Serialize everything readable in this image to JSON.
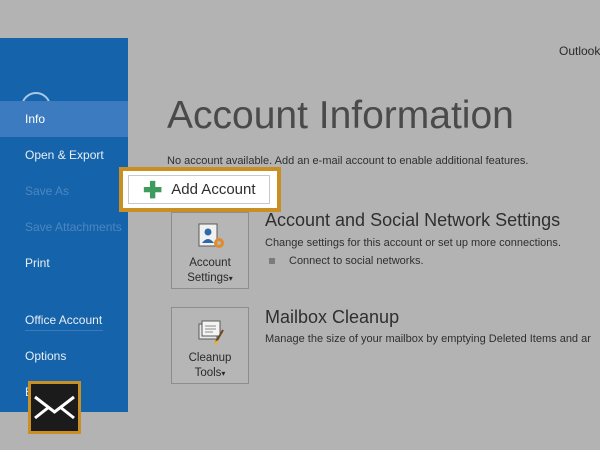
{
  "app": {
    "name": "Outlook"
  },
  "sidebar": {
    "back_label": "Back",
    "items": [
      {
        "label": "Info",
        "state": "active"
      },
      {
        "label": "Open & Export",
        "state": "normal"
      },
      {
        "label": "Save As",
        "state": "disabled"
      },
      {
        "label": "Save Attachments",
        "state": "disabled"
      },
      {
        "label": "Print",
        "state": "normal"
      },
      {
        "label": "Office Account",
        "state": "normal"
      },
      {
        "label": "Options",
        "state": "normal"
      },
      {
        "label": "E",
        "state": "normal"
      }
    ]
  },
  "main": {
    "title": "Account Information",
    "no_account_text": "No account available. Add an e-mail account to enable additional features.",
    "add_account_label": "Add Account",
    "sections": [
      {
        "tile_line1": "Account",
        "tile_line2": "Settings",
        "tile_arrow": "▾",
        "title": "Account and Social Network Settings",
        "description": "Change settings for this account or set up more connections.",
        "bullet": "Connect to social networks."
      },
      {
        "tile_line1": "Cleanup",
        "tile_line2": "Tools",
        "tile_arrow": "▾",
        "title": "Mailbox Cleanup",
        "description": "Manage the size of your mailbox by emptying Deleted Items and ar"
      }
    ]
  },
  "colors": {
    "sidebar": "#1564ab",
    "sidebar_active": "#3c7bbf",
    "highlight": "#c98f22",
    "plus": "#3f9a5e",
    "background": "#b3b3b3"
  },
  "icons": [
    "back-arrow-icon",
    "plus-icon",
    "account-settings-icon",
    "cleanup-tools-icon",
    "mail-envelope-icon"
  ]
}
